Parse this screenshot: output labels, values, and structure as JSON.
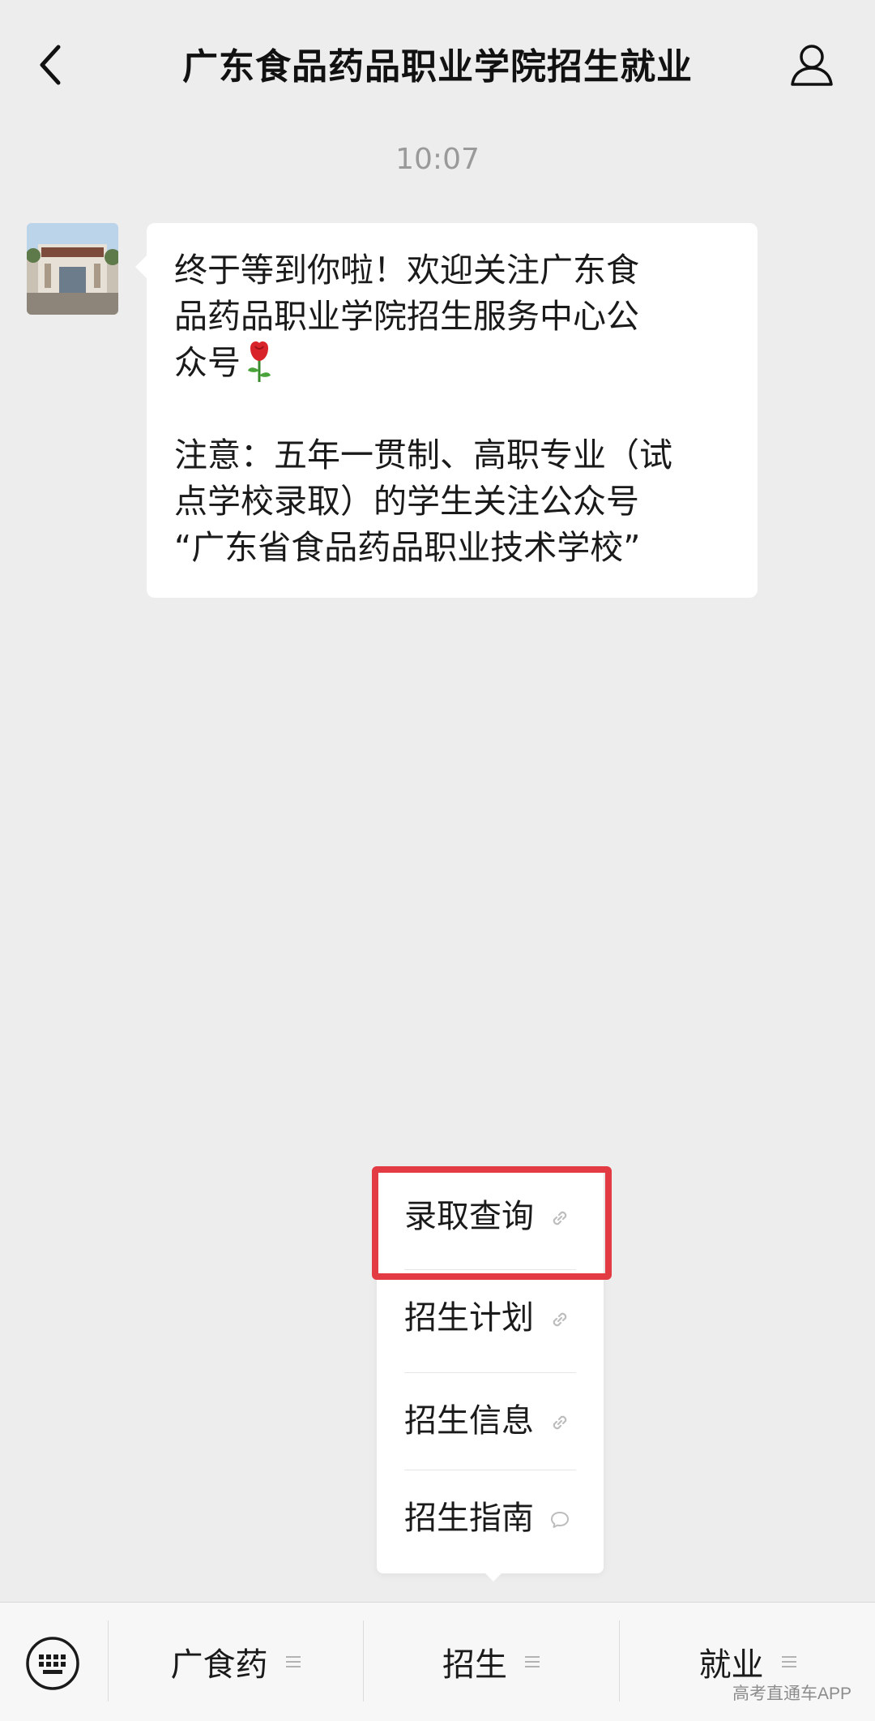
{
  "header": {
    "title": "广东食品药品职业学院招生就业",
    "back_icon": "chevron-left-icon",
    "profile_icon": "user-icon"
  },
  "chat": {
    "timestamp": "10:07",
    "message_lines": [
      "终于等到你啦！欢迎关注广东食",
      "品药品职业学院招生服务中心公",
      "众号",
      "",
      "注意：五年一贯制、高职专业（试",
      "点学校录取）的学生关注公众号",
      "“广东省食品药品职业技术学校”"
    ],
    "emoji": "rose-emoji"
  },
  "popup_menu": {
    "items": [
      {
        "label": "录取查询",
        "icon": "link-icon"
      },
      {
        "label": "招生计划",
        "icon": "link-icon"
      },
      {
        "label": "招生信息",
        "icon": "link-icon"
      },
      {
        "label": "招生指南",
        "icon": "message-bubble-icon"
      }
    ],
    "highlight_color": "#e23b43"
  },
  "bottom_bar": {
    "keyboard_icon": "keyboard-icon",
    "tabs": [
      {
        "label": "广食药"
      },
      {
        "label": "招生"
      },
      {
        "label": "就业"
      }
    ]
  },
  "watermark": "高考直通车APP"
}
